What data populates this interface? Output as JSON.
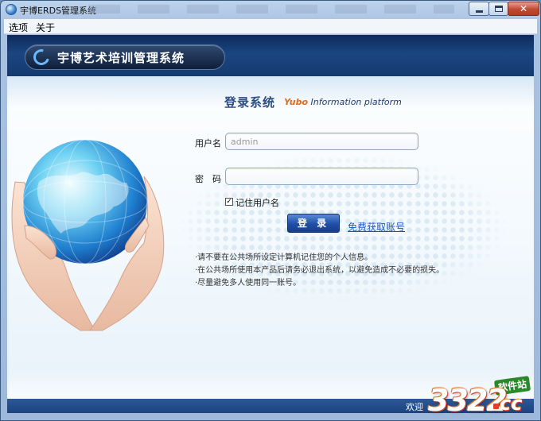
{
  "window": {
    "title": "宇博ERDS管理系统"
  },
  "menu": {
    "items": [
      "选项",
      "关于"
    ]
  },
  "header": {
    "product_name": "宇博艺术培训管理系统"
  },
  "login": {
    "title": "登录系统",
    "subtitle_accent": "Yubo",
    "subtitle_rest": " Information platform",
    "username_label": "用户名",
    "username_value": "admin",
    "password_label": "密　码",
    "password_value": "",
    "remember_label": "记住用户名",
    "remember_checked": true,
    "submit_label": "登 录",
    "free_account_link": "免费获取账号"
  },
  "notices": [
    "·请不要在公共场所设定计算机记住您的个人信息。",
    "·在公共场所使用本产品后请务必退出系统，以避免造成不必要的损失。",
    "·尽量避免多人使用同一账号。"
  ],
  "footer": {
    "text": "欢迎"
  },
  "watermark": {
    "number": "3322",
    "domain": "cc",
    "tag": "软件站"
  },
  "colors": {
    "header_band": "#153a70",
    "accent_orange": "#e06b1c",
    "link_blue": "#1a55c8",
    "button_blue": "#1f4fa6"
  }
}
